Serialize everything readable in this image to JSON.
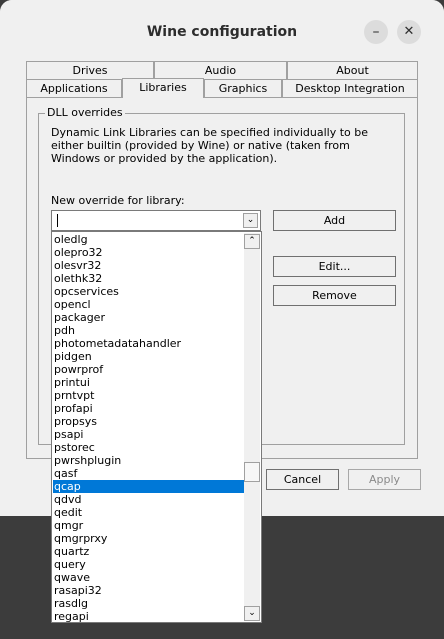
{
  "window": {
    "title": "Wine configuration",
    "minimize_glyph": "–",
    "close_glyph": "✕"
  },
  "tabs": {
    "row1": [
      "Drives",
      "Audio",
      "About"
    ],
    "row2": [
      "Applications",
      "Libraries",
      "Graphics",
      "Desktop Integration"
    ],
    "active": "Libraries"
  },
  "group": {
    "title": "DLL overrides",
    "description": "Dynamic Link Libraries can be specified individually to be either builtin (provided by Wine) or native (taken from Windows or provided by the application).",
    "new_override_label": "New override for library:",
    "combo_value": ""
  },
  "buttons": {
    "add": "Add",
    "edit": "Edit...",
    "remove": "Remove",
    "cancel": "Cancel",
    "apply": "Apply"
  },
  "icons": {
    "combo_arrow": "chevron-down-icon",
    "scroll_up": "chevron-up-icon",
    "scroll_down": "chevron-down-icon"
  },
  "dropdown": {
    "items": [
      "oledlg",
      "olepro32",
      "olesvr32",
      "olethk32",
      "opcservices",
      "opencl",
      "packager",
      "pdh",
      "photometadatahandler",
      "pidgen",
      "powrprof",
      "printui",
      "prntvpt",
      "profapi",
      "propsys",
      "psapi",
      "pstorec",
      "pwrshplugin",
      "qasf",
      "qcap",
      "qdvd",
      "qedit",
      "qmgr",
      "qmgrprxy",
      "quartz",
      "query",
      "qwave",
      "rasapi32",
      "rasdlg",
      "regapi"
    ],
    "selected": "qcap"
  },
  "colors": {
    "selection": "#0078d7",
    "window_bg": "#f0f0f0",
    "desktop_bg": "#3c3c3c"
  }
}
